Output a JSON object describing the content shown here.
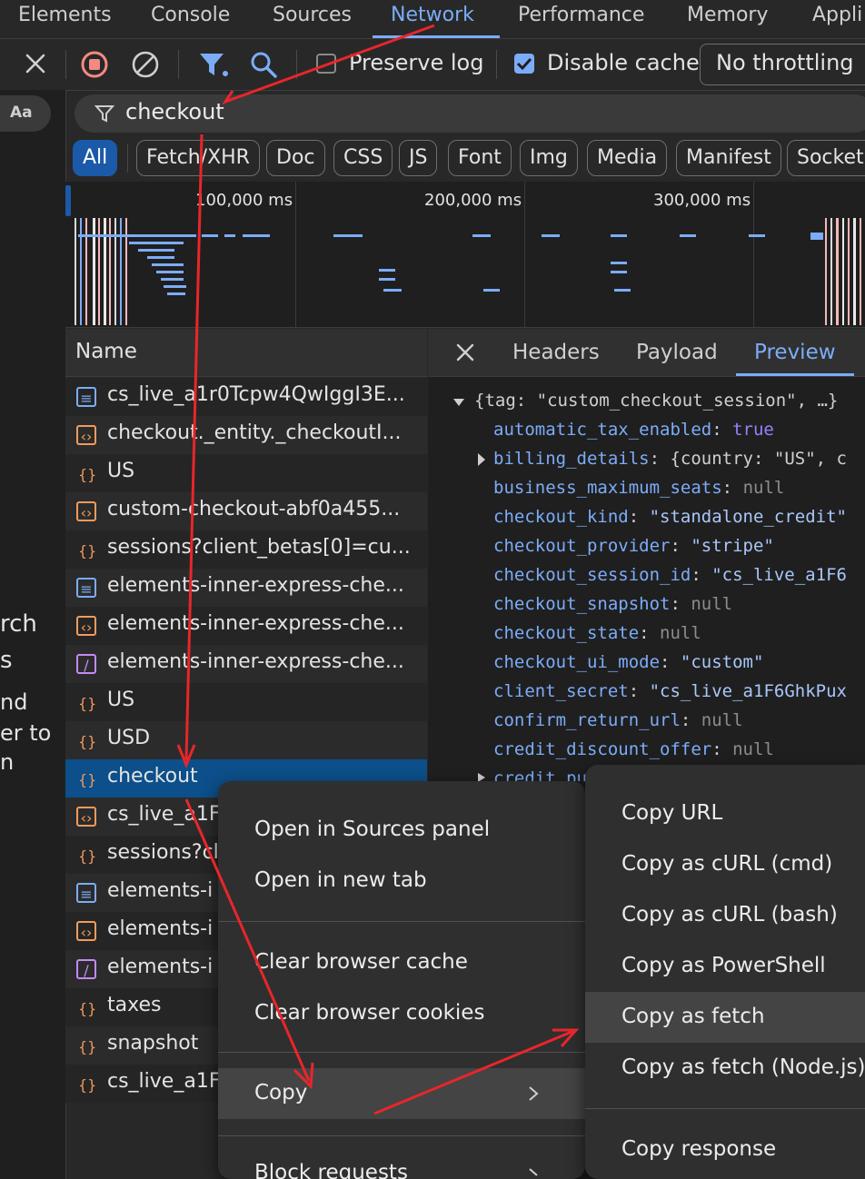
{
  "top_tabs": [
    "Elements",
    "Console",
    "Sources",
    "Network",
    "Performance",
    "Memory",
    "Appli"
  ],
  "toolbar": {
    "preserve_log_label": "Preserve log",
    "disable_cache_label": "Disable cache",
    "throttling_value": "No throttling"
  },
  "left_panel": {
    "aa_label": "Aa",
    "text_fragments": [
      "rch",
      "s",
      "nd",
      "er to",
      "n"
    ]
  },
  "filter": {
    "value": "checkout"
  },
  "type_filters": [
    "All",
    "Fetch/XHR",
    "Doc",
    "CSS",
    "JS",
    "Font",
    "Img",
    "Media",
    "Manifest",
    "Socket"
  ],
  "timeline": {
    "ticks": [
      "100,000 ms",
      "200,000 ms",
      "300,000 ms"
    ]
  },
  "requests": {
    "header": "Name",
    "rows": [
      {
        "icon": "doc",
        "name": "cs_live_a1r0Tcpw4QwIggI3E..."
      },
      {
        "icon": "script",
        "name": "checkout._entity._checkoutI..."
      },
      {
        "icon": "fetch",
        "name": "US"
      },
      {
        "icon": "script",
        "name": "custom-checkout-abf0a455..."
      },
      {
        "icon": "fetch",
        "name": "sessions?client_betas[0]=cu..."
      },
      {
        "icon": "doc",
        "name": "elements-inner-express-che..."
      },
      {
        "icon": "script",
        "name": "elements-inner-express-che..."
      },
      {
        "icon": "style",
        "name": "elements-inner-express-che..."
      },
      {
        "icon": "fetch",
        "name": "US"
      },
      {
        "icon": "fetch",
        "name": "USD"
      },
      {
        "icon": "fetch",
        "name": "checkout"
      },
      {
        "icon": "script",
        "name": "cs_live_a1F"
      },
      {
        "icon": "fetch",
        "name": "sessions?cl"
      },
      {
        "icon": "doc",
        "name": "elements-i"
      },
      {
        "icon": "script",
        "name": "elements-i"
      },
      {
        "icon": "style",
        "name": "elements-i"
      },
      {
        "icon": "fetch",
        "name": "taxes"
      },
      {
        "icon": "fetch",
        "name": "snapshot"
      },
      {
        "icon": "fetch",
        "name": "cs_live_a1F"
      }
    ]
  },
  "detail_tabs": [
    "Headers",
    "Payload",
    "Preview"
  ],
  "preview": {
    "root": "{tag: \"custom_checkout_session\", …}",
    "lines": [
      {
        "key": "automatic_tax_enabled",
        "value": "true",
        "type": "bool"
      },
      {
        "key": "billing_details",
        "value": "{country: \"US\", c",
        "type": "obj"
      },
      {
        "key": "business_maximum_seats",
        "value": "null",
        "type": "null"
      },
      {
        "key": "checkout_kind",
        "value": "\"standalone_credit\"",
        "type": "str"
      },
      {
        "key": "checkout_provider",
        "value": "\"stripe\"",
        "type": "str"
      },
      {
        "key": "checkout_session_id",
        "value": "\"cs_live_a1F6",
        "type": "str"
      },
      {
        "key": "checkout_snapshot",
        "value": "null",
        "type": "null"
      },
      {
        "key": "checkout_state",
        "value": "null",
        "type": "null"
      },
      {
        "key": "checkout_ui_mode",
        "value": "\"custom\"",
        "type": "str"
      },
      {
        "key": "client_secret",
        "value": "\"cs_live_a1F6GhkPux",
        "type": "str"
      },
      {
        "key": "confirm_return_url",
        "value": "null",
        "type": "null"
      },
      {
        "key": "credit_discount_offer",
        "value": "null",
        "type": "null"
      }
    ],
    "partial_line": "credit_pu"
  },
  "context_menu": {
    "items": [
      "Open in Sources panel",
      "Open in new tab",
      "Clear browser cache",
      "Clear browser cookies",
      "Copy",
      "Block requests"
    ]
  },
  "copy_submenu": {
    "items": [
      "Copy URL",
      "Copy as cURL (cmd)",
      "Copy as cURL (bash)",
      "Copy as PowerShell",
      "Copy as fetch",
      "Copy as fetch (Node.js)",
      "Copy response"
    ],
    "highlighted": "Copy as fetch"
  },
  "colors": {
    "accent": "#7cacf8",
    "selected_row": "#0c4f8a",
    "annotation_arrow": "#e8262b",
    "record_stop": "#f28b82",
    "chip_active": "#1b5aa8"
  }
}
